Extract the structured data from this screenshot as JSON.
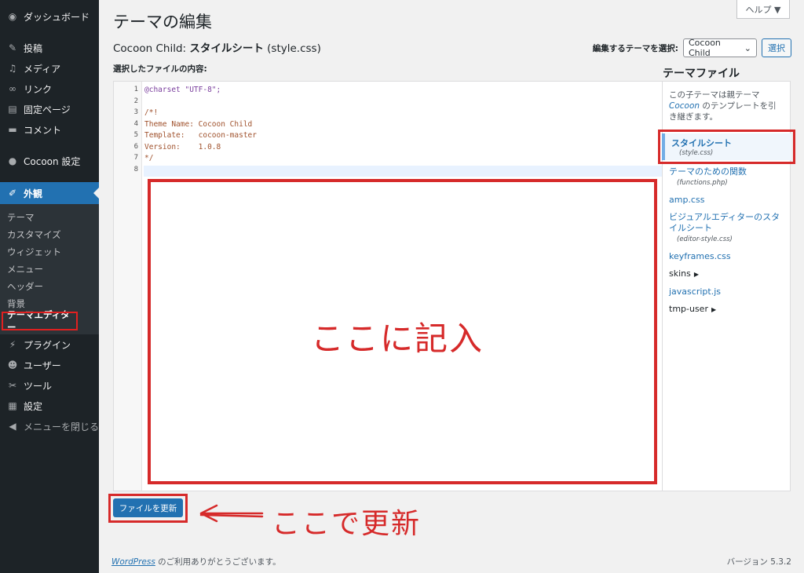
{
  "sidebar": {
    "dashboard": "ダッシュボード",
    "posts": "投稿",
    "media": "メディア",
    "links": "リンク",
    "pages": "固定ページ",
    "comments": "コメント",
    "cocoon": "Cocoon 設定",
    "appearance": "外観",
    "sub": [
      "テーマ",
      "カスタマイズ",
      "ウィジェット",
      "メニュー",
      "ヘッダー",
      "背景",
      "テーマエディター"
    ],
    "plugins": "プラグイン",
    "users": "ユーザー",
    "tools": "ツール",
    "settings": "設定",
    "collapse": "メニューを閉じる"
  },
  "header": {
    "title": "テーマの編集",
    "help": "ヘルプ ▼",
    "file_theme": "Cocoon Child: ",
    "file_name": "スタイルシート",
    "file_path": " (style.css)",
    "select_label": "編集するテーマを選択:",
    "select_value": "Cocoon Child",
    "select_button": "選択",
    "content_label": "選択したファイルの内容:"
  },
  "editor": {
    "line_numbers": [
      "1",
      "2",
      "3",
      "4",
      "5",
      "6",
      "7",
      "8"
    ],
    "lines": [
      "@charset \"UTF-8\";",
      "",
      "/*!",
      "Theme Name: Cocoon Child",
      "Template:   cocoon-master",
      "Version:    1.0.8",
      "*/",
      ""
    ]
  },
  "annotations": {
    "write_here": "ここに記入",
    "update_here": "ここで更新",
    "color": "#d62a2a"
  },
  "file_list": {
    "title": "テーマファイル",
    "note_before": "この子テーマは親テーマ ",
    "note_parent": "Cocoon",
    "note_after": " のテンプレートを引き継ぎます。",
    "current": {
      "label": "スタイルシート",
      "file": "(style.css)"
    },
    "items": [
      {
        "label": "テーマのための関数",
        "file": "(functions.php)"
      },
      {
        "label": "amp.css",
        "file": ""
      },
      {
        "label": "ビジュアルエディターのスタイルシート",
        "file": "(editor-style.css)"
      },
      {
        "label": "keyframes.css",
        "file": ""
      }
    ],
    "dirs": [
      "skins",
      "javascript.js",
      "tmp-user"
    ]
  },
  "update_button": "ファイルを更新",
  "footer": {
    "wp_link": "WordPress",
    "thanks": " のご利用ありがとうございます。",
    "version": "バージョン 5.3.2"
  },
  "colors": {
    "sidebar_bg": "#1d2327",
    "accent": "#2271b1"
  }
}
